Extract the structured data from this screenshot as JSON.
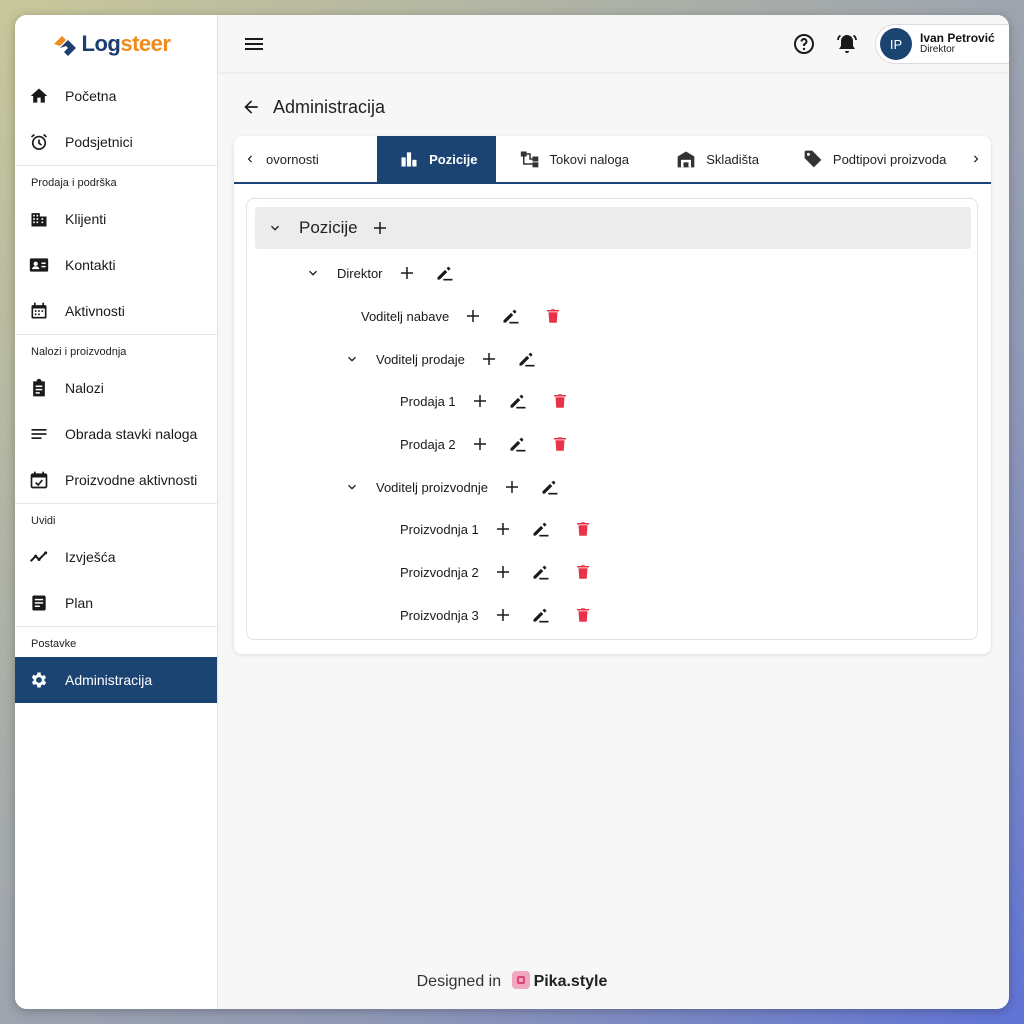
{
  "brand": {
    "logo_text_main": "Log",
    "logo_text_accent": "steer",
    "brand_color": "#1c4473"
  },
  "sidebar": {
    "items": [
      {
        "label": "Početna",
        "icon": "home-icon"
      },
      {
        "label": "Podsjetnici",
        "icon": "alarm-icon"
      },
      {
        "section": "Prodaja i podrška"
      },
      {
        "label": "Klijenti",
        "icon": "building-icon"
      },
      {
        "label": "Kontakti",
        "icon": "contact-card-icon"
      },
      {
        "label": "Aktivnosti",
        "icon": "calendar-icon"
      },
      {
        "section": "Nalozi i proizvodnja"
      },
      {
        "label": "Nalozi",
        "icon": "clipboard-icon"
      },
      {
        "label": "Obrada stavki naloga",
        "icon": "list-icon"
      },
      {
        "label": "Proizvodne aktivnosti",
        "icon": "calendar-check-icon"
      },
      {
        "section": "Uvidi"
      },
      {
        "label": "Izvješća",
        "icon": "trend-icon"
      },
      {
        "label": "Plan",
        "icon": "document-icon"
      },
      {
        "section": "Postavke"
      },
      {
        "label": "Administracija",
        "icon": "gear-icon",
        "active": true
      }
    ]
  },
  "topbar": {
    "user_initials": "IP",
    "user_name": "Ivan Petrović",
    "user_role": "Direktor"
  },
  "page": {
    "title": "Administracija"
  },
  "tabs": [
    {
      "label": "ovornosti",
      "icon": ""
    },
    {
      "label": "Pozicije",
      "icon": "bar-chart-icon",
      "active": true
    },
    {
      "label": "Tokovi naloga",
      "icon": "flow-icon"
    },
    {
      "label": "Skladišta",
      "icon": "warehouse-icon"
    },
    {
      "label": "Podtipovi proizvoda",
      "icon": "tag-icon"
    }
  ],
  "tree": {
    "root_label": "Pozicije",
    "nodes": [
      {
        "label": "Direktor"
      },
      {
        "label": "Voditelj nabave"
      },
      {
        "label": "Voditelj prodaje"
      },
      {
        "label": "Prodaja 1"
      },
      {
        "label": "Prodaja 2"
      },
      {
        "label": "Voditelj proizvodnje"
      },
      {
        "label": "Proizvodnja 1"
      },
      {
        "label": "Proizvodnja 2"
      },
      {
        "label": "Proizvodnja 3"
      }
    ]
  },
  "colors": {
    "delete": "#e8334a",
    "accent": "#1c4473"
  },
  "footer": {
    "prefix": "Designed in",
    "brand": "Pika.style"
  }
}
